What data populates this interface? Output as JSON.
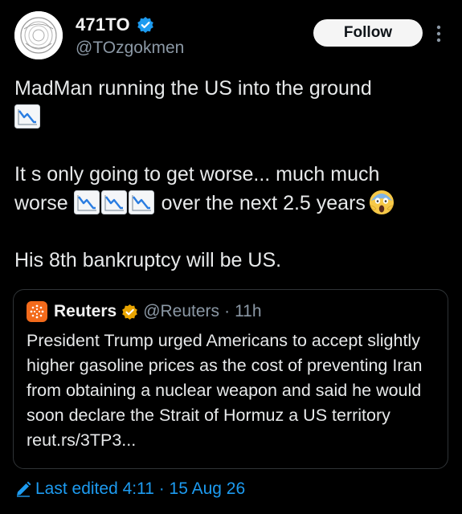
{
  "author": {
    "display_name": "471TO",
    "handle": "@TOzgokmen",
    "verified": true,
    "verified_color": "#1d9bf0"
  },
  "follow_label": "Follow",
  "more_icon": "more-vertical-icon",
  "post": {
    "line1": "MadMan running the US into the ground",
    "line2a": "It s only going to get worse... much much",
    "line2b_pre": "worse",
    "line2b_post": "over the next 2.5 years",
    "line3": "His 8th bankruptcy will be US.",
    "emoji_chart": "chart-decreasing-emoji",
    "emoji_scream": "face-screaming-in-fear-emoji"
  },
  "quote": {
    "name": "Reuters",
    "handle": "@Reuters",
    "separator": "·",
    "time": "11h",
    "badge_color": "#e8a400",
    "logo_color": "#f26a1b",
    "text": "President Trump urged Americans to accept slightly higher gasoline prices as the cost of preventing Iran from obtaining a nuclear weapon and said he would soon declare the Strait of Hormuz a US territory reut.rs/3TP3..."
  },
  "footer": {
    "edited_text": "Last edited 4:11 · 15 Aug 26",
    "link_color": "#1d9bf0"
  }
}
